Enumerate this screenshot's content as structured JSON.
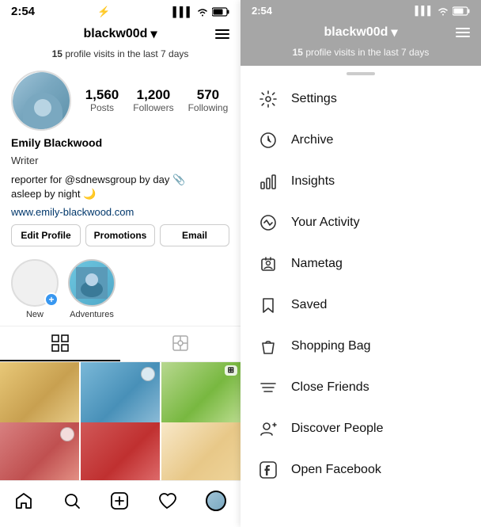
{
  "left": {
    "status": {
      "time": "2:54",
      "signal_icon": "signal-icon",
      "wifi_icon": "wifi-icon",
      "battery_icon": "battery-icon"
    },
    "header": {
      "username": "blackw00d",
      "chevron": "▾",
      "menu_icon": "menu-icon"
    },
    "profile_visits": {
      "count": "15",
      "text": "profile visits in the last 7 days"
    },
    "stats": [
      {
        "number": "1,560",
        "label": "Posts"
      },
      {
        "number": "1,200",
        "label": "Followers"
      },
      {
        "number": "570",
        "label": "Following"
      }
    ],
    "profile": {
      "name": "Emily Blackwood",
      "title": "Writer",
      "bio": "reporter for @sdnewsgroup by day 📎\nasleep by night 🌙",
      "website": "www.emily-blackwood.com"
    },
    "buttons": [
      {
        "label": "Edit Profile"
      },
      {
        "label": "Promotions"
      },
      {
        "label": "Email"
      }
    ],
    "stories": [
      {
        "label": "New",
        "type": "new"
      },
      {
        "label": "Adventures",
        "type": "photo"
      }
    ],
    "tabs": [
      {
        "label": "grid-icon",
        "active": true
      },
      {
        "label": "tag-icon",
        "active": false
      }
    ],
    "bottom_nav": [
      {
        "label": "home-icon"
      },
      {
        "label": "search-icon"
      },
      {
        "label": "add-icon"
      },
      {
        "label": "heart-icon"
      },
      {
        "label": "profile-icon"
      }
    ]
  },
  "right": {
    "status": {
      "time": "2:54"
    },
    "header": {
      "username": "blackw00d"
    },
    "profile_visits": {
      "count": "15",
      "text": "profile visits in the last 7 days"
    },
    "menu_items": [
      {
        "id": "settings",
        "label": "Settings",
        "icon": "settings-icon"
      },
      {
        "id": "archive",
        "label": "Archive",
        "icon": "archive-icon"
      },
      {
        "id": "insights",
        "label": "Insights",
        "icon": "insights-icon"
      },
      {
        "id": "your-activity",
        "label": "Your Activity",
        "icon": "activity-icon"
      },
      {
        "id": "nametag",
        "label": "Nametag",
        "icon": "nametag-icon"
      },
      {
        "id": "saved",
        "label": "Saved",
        "icon": "saved-icon"
      },
      {
        "id": "shopping-bag",
        "label": "Shopping Bag",
        "icon": "bag-icon"
      },
      {
        "id": "close-friends",
        "label": "Close Friends",
        "icon": "friends-icon"
      },
      {
        "id": "discover-people",
        "label": "Discover People",
        "icon": "discover-icon"
      },
      {
        "id": "open-facebook",
        "label": "Open Facebook",
        "icon": "facebook-icon"
      }
    ]
  }
}
